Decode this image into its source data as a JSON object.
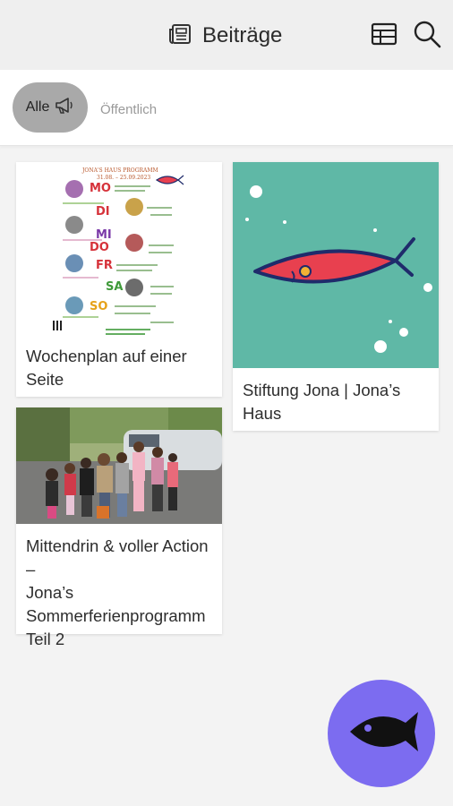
{
  "header": {
    "title": "Beiträge",
    "left_icon": "news-icon",
    "right_icons": [
      "table-icon",
      "search-icon"
    ]
  },
  "filters": {
    "all_label": "Alle",
    "all_icon": "megaphone-icon",
    "public_label": "Öffentlich"
  },
  "posts": [
    {
      "title": "Wochenplan auf einer Seite"
    },
    {
      "title": "Stiftung Jona | Jona’s Haus"
    },
    {
      "title": "Mittendrin & voller Action –\n Jona’s Sommerferienprogramm Teil 2"
    }
  ],
  "poster": {
    "heading": "JONA'S HAUS PROGRAMM",
    "dates": "31.08. – 25.09.2023",
    "days": [
      "MO",
      "DI",
      "MI",
      "DO",
      "FR",
      "SA",
      "SO"
    ]
  },
  "fab": {
    "icon": "fish-icon"
  },
  "colors": {
    "accent": "#7c6cf0",
    "chip": "#a9a9a9",
    "teal": "#5fb8a6",
    "fish_red": "#e8404f",
    "fish_navy": "#1f2b6b"
  }
}
